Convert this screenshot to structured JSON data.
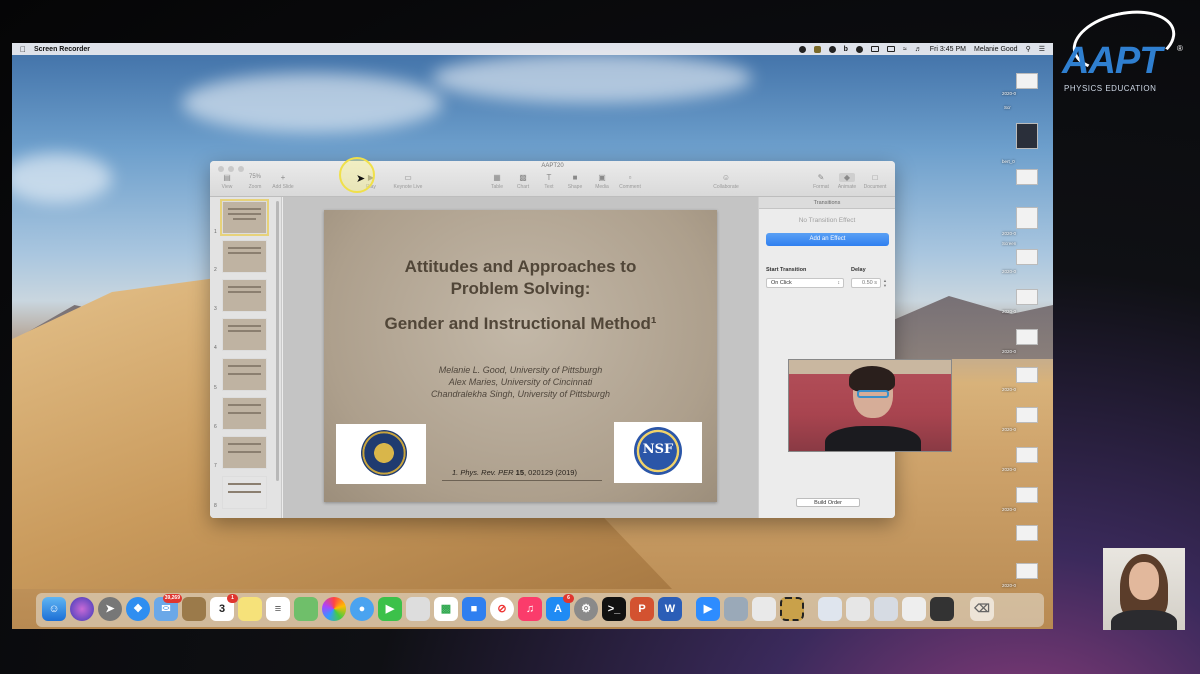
{
  "menubar": {
    "app_name": "Screen Recorder",
    "clock": "Fri 3:45 PM",
    "user": "Melanie Good"
  },
  "keynote": {
    "window_title": "AAPT20",
    "toolbar": {
      "view": "View",
      "zoom_value": "75%",
      "zoom": "Zoom",
      "add_slide": "Add Slide",
      "play": "Play",
      "keynote_live": "Keynote Live",
      "table": "Table",
      "chart": "Chart",
      "text": "Text",
      "shape": "Shape",
      "media": "Media",
      "comment": "Comment",
      "collaborate": "Collaborate",
      "format": "Format",
      "animate": "Animate",
      "document": "Document"
    },
    "navigator": {
      "slide_numbers": [
        "1",
        "2",
        "3",
        "4",
        "5",
        "6",
        "7",
        "8"
      ]
    },
    "slide": {
      "title_line1": "Attitudes and Approaches to",
      "title_line2": "Problem Solving:",
      "subtitle": "Gender and Instructional Method¹",
      "author1": "Melanie L. Good, University of Pittsburgh",
      "author2": "Alex Maries, University of Cincinnati",
      "author3": "Chandralekha Singh, University of Pittsburgh",
      "ref_prefix": "1. Phys. Rev. PER",
      "ref_volume": "15",
      "ref_suffix": ", 020129 (2019)",
      "nsf_logo_text": "NSF"
    },
    "inspector": {
      "header": "Transitions",
      "no_effect": "No Transition Effect",
      "add_effect": "Add an Effect",
      "start_transition_label": "Start Transition",
      "start_transition_value": "On Click",
      "delay_label": "Delay",
      "delay_value": "0.50 s",
      "build_order": "Build Order"
    }
  },
  "aapt_logo": {
    "word": "AAPT",
    "tagline": "PHYSICS EDUCATION"
  },
  "dock": {
    "mail_badge": "39,269",
    "calendar_day": "3",
    "calendar_badge": "1",
    "appstore_badge": "6"
  },
  "desktop_files": {
    "labels": [
      "2020-0",
      "bert_0",
      "Scr",
      "2020-0",
      "Screen",
      "2020-0",
      "2020-0",
      "2020-0",
      "2020-0",
      "2020-0",
      "2020-0",
      "2020-0",
      "2020-0"
    ]
  }
}
